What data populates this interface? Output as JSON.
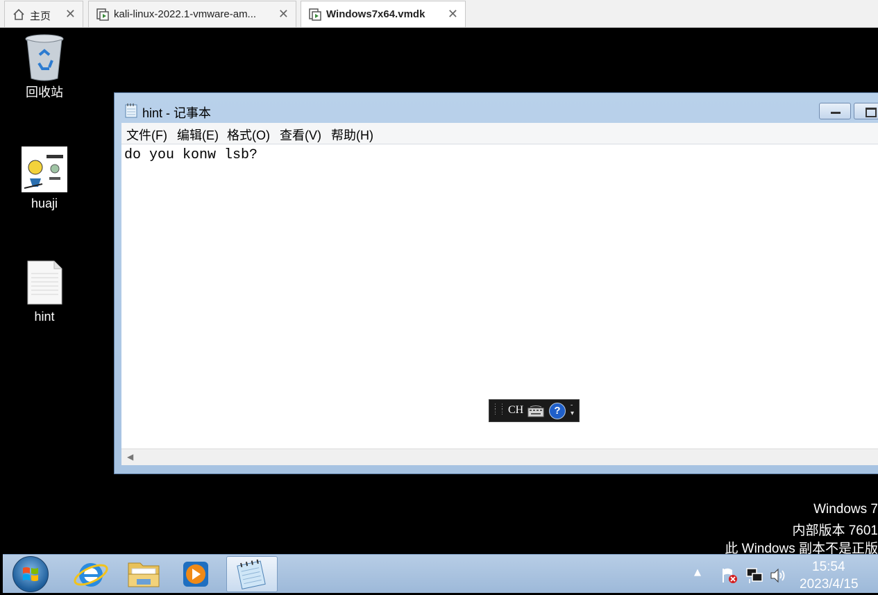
{
  "tabs": [
    {
      "label": "主页",
      "icon": "home-icon",
      "active": false
    },
    {
      "label": "kali-linux-2022.1-vmware-am...",
      "icon": "vm-icon",
      "active": false
    },
    {
      "label": "Windows7x64.vmdk",
      "icon": "vm-icon",
      "active": true
    }
  ],
  "desktop": {
    "icons": [
      {
        "label": "回收站",
        "icon": "recycle-bin-icon"
      },
      {
        "label": "huaji",
        "icon": "image-file-icon"
      },
      {
        "label": "hint",
        "icon": "text-file-icon"
      }
    ]
  },
  "notepad": {
    "title": "hint - 记事本",
    "menu": [
      "文件(F)",
      "编辑(E)",
      "格式(O)",
      "查看(V)",
      "帮助(H)"
    ],
    "content": "do you konw lsb?"
  },
  "ime": {
    "label": "CH"
  },
  "watermark": {
    "line1": "Windows 7",
    "line2": "内部版本 7601",
    "line3": "此 Windows 副本不是正版"
  },
  "taskbar": {
    "items": [
      "start-button",
      "internet-explorer-icon",
      "file-explorer-icon",
      "media-player-icon",
      "notepad-icon"
    ],
    "time": "15:54",
    "date": "2023/4/15"
  },
  "colors": {
    "taskbar": "#a9c4e2",
    "window_frame": "#b9d1ea",
    "desktop": "#000000"
  }
}
